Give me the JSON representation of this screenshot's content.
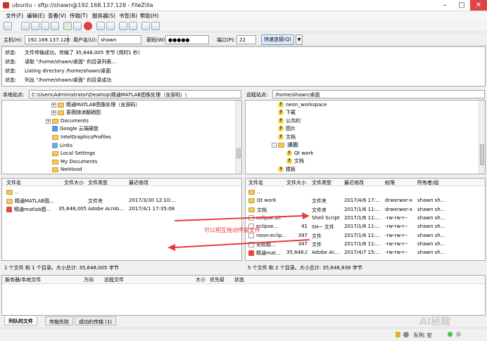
{
  "window": {
    "title": "ubuntu - sftp://shawn@192.168.137.128 - FileZilla"
  },
  "menu": [
    "文件(F)",
    "编辑(E)",
    "查看(V)",
    "传输(T)",
    "服务器(S)",
    "书签(B)",
    "帮助(H)"
  ],
  "quickconnect": {
    "host_label": "主机(H):",
    "host_value": "192.168.137.128",
    "user_label": "用户名(U):",
    "user_value": "shawn",
    "pass_label": "密码(W):",
    "pass_value": "●●●●●",
    "port_label": "端口(P):",
    "port_value": "22",
    "connect_label": "快速连接(Q)"
  },
  "log": [
    {
      "k": "状态:",
      "v": "文件传输成功，传输了 35,648,005 字节 (用时1 秒)"
    },
    {
      "k": "状态:",
      "v": "读取 \"/home/shawn/桌面\" 的目录列表..."
    },
    {
      "k": "状态:",
      "v": "Listing directory /home/shawn/桌面"
    },
    {
      "k": "状态:",
      "v": "列出 \"/home/shawn/桌面\" 的目录成功"
    }
  ],
  "local": {
    "site_label": "本地站点:",
    "site_path": "C:\\Users\\Administrator\\Desktop\\精通MATLAB图像处理（含源码）\\",
    "tree": [
      {
        "label": "精通MATLAB图像处理（含源码）",
        "exp": "+"
      },
      {
        "label": "蔷薇随谅翻硒图",
        "exp": "+"
      },
      {
        "label": "Documents",
        "exp": "+"
      },
      {
        "label": "Google 云端硬盘",
        "exp": ""
      },
      {
        "label": "IntelGraphicsProfiles",
        "exp": ""
      },
      {
        "label": "Links",
        "exp": ""
      },
      {
        "label": "Local Settings",
        "exp": ""
      },
      {
        "label": "My Documents",
        "exp": ""
      },
      {
        "label": "NetHood",
        "exp": ""
      }
    ],
    "columns": [
      "文件名",
      "文件大小",
      "文件类型",
      "最近修改"
    ],
    "files": [
      {
        "name": "..",
        "size": "",
        "type": "",
        "modified": "",
        "kind": "folder"
      },
      {
        "name": "精通MATLAB图...",
        "size": "",
        "type": "文件夹",
        "modified": "2017/3/30 12:10:...",
        "kind": "folder"
      },
      {
        "name": "精通matlab图...",
        "size": "35,648,005",
        "type": "Adobe Acrob...",
        "modified": "2017/4/1 17:35:08",
        "kind": "pdf"
      }
    ],
    "status": "1 个文件 和 1 个目录。大小总计: 35,648,005 字节"
  },
  "remote": {
    "site_label": "远程站点:",
    "site_path": "/home/shawn/桌面",
    "tree": [
      {
        "label": "neon_workspace",
        "ind": 0
      },
      {
        "label": "下载",
        "ind": 0
      },
      {
        "label": "公共的",
        "ind": 0
      },
      {
        "label": "图片",
        "ind": 0
      },
      {
        "label": "文档",
        "ind": 0
      },
      {
        "label": "桌面",
        "ind": 0,
        "folder": true,
        "exp": "-"
      },
      {
        "label": "Qt work",
        "ind": 1
      },
      {
        "label": "文档",
        "ind": 1
      },
      {
        "label": "模板",
        "ind": 0
      }
    ],
    "columns": [
      "文件名",
      "文件大小",
      "文件类型",
      "最近修改",
      "权限",
      "所有者/组"
    ],
    "files": [
      {
        "name": "..",
        "size": "",
        "type": "",
        "modified": "",
        "perm": "",
        "owner": "",
        "kind": "folder"
      },
      {
        "name": "Qt work",
        "size": "",
        "type": "文件夹",
        "modified": "2017/4/6 17:...",
        "perm": "drwxrwxr-x",
        "owner": "shawn sh...",
        "kind": "folder"
      },
      {
        "name": "文档",
        "size": "",
        "type": "文件夹",
        "modified": "2017/1/6 11:...",
        "perm": "drwxrwxr-x",
        "owner": "shawn sh...",
        "kind": "folder"
      },
      {
        "name": "eclipse.sh",
        "size": "",
        "type": "Shell Script",
        "modified": "2017/1/6 11:...",
        "perm": "-rw-rw-r--",
        "owner": "shawn sh...",
        "kind": "file"
      },
      {
        "name": "eclipse...",
        "size": "41",
        "type": "SH~ 文件",
        "modified": "2017/1/6 11:...",
        "perm": "-rw-rw-r--",
        "owner": "shawn sh...",
        "kind": "file"
      },
      {
        "name": "neon-eclip...",
        "size": "397",
        "type": "文件",
        "modified": "2017/1/6 11:...",
        "perm": "-rw-rw-r--",
        "owner": "shawn sh...",
        "kind": "file"
      },
      {
        "name": "无标题...",
        "size": "347",
        "type": "文件",
        "modified": "2017/1/6 11:...",
        "perm": "-rw-rw-r--",
        "owner": "shawn sh...",
        "kind": "file"
      },
      {
        "name": "精通mat...",
        "size": "35,648,005",
        "type": "Adobe Ac...",
        "modified": "2017/4/7 15:...",
        "perm": "-rw-rw-r--",
        "owner": "shawn sh...",
        "kind": "pdf"
      }
    ],
    "status": "5 个文件 和 2 个目录。大小总计: 35,648,838 字节"
  },
  "queue": {
    "columns": [
      "服务器/本地文件",
      "方向",
      "远程文件",
      "大小",
      "优先级",
      "状态"
    ],
    "tabs": [
      "列队的文件",
      "传输失败",
      "成功的传输 (1)"
    ]
  },
  "annotation": "可以相互拖动传输文件",
  "statusbar": {
    "queue": "队列: 空"
  },
  "watermark": "AI秘籍",
  "colors": {
    "annotation": "#e83b3b",
    "accent": "#3b73c8"
  }
}
